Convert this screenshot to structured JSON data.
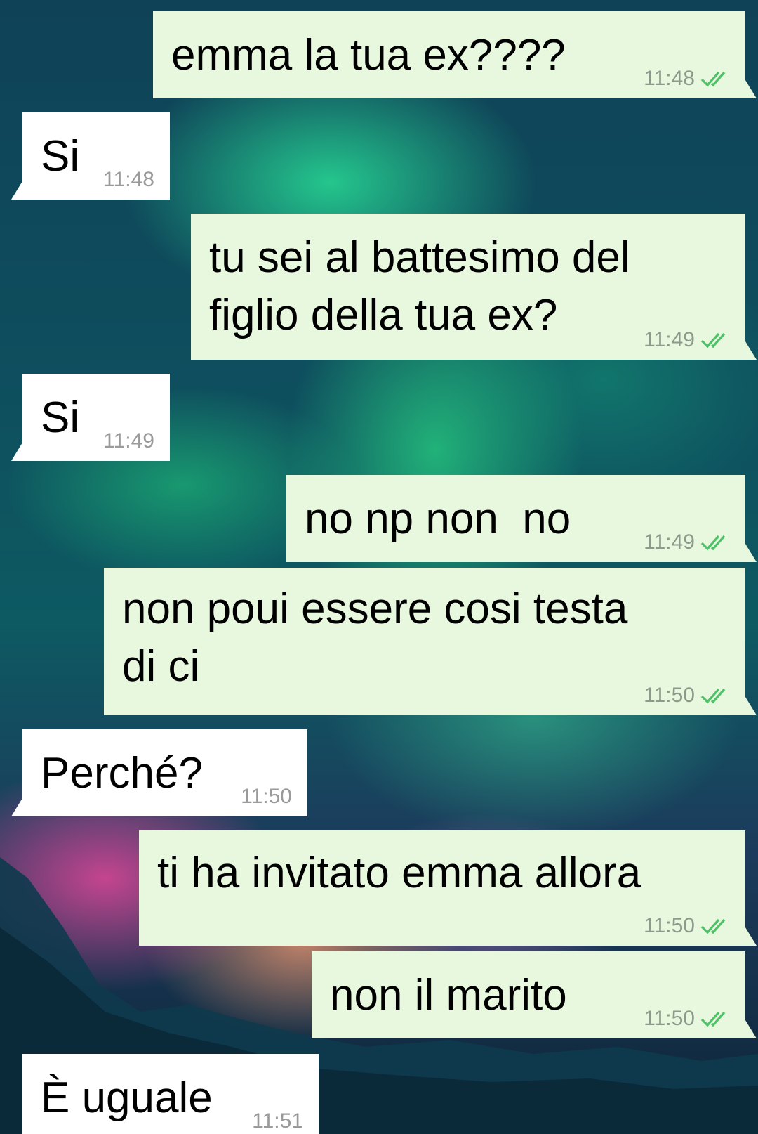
{
  "conversation": {
    "messages": [
      {
        "direction": "out",
        "lines": [
          "emma la tua ex????"
        ],
        "time": "11:48",
        "status": "read"
      },
      {
        "direction": "in",
        "lines": [
          "Si"
        ],
        "time": "11:48"
      },
      {
        "direction": "out",
        "lines": [
          "tu sei al battesimo del",
          "figlio della tua ex?"
        ],
        "time": "11:49",
        "status": "read"
      },
      {
        "direction": "in",
        "lines": [
          "Si"
        ],
        "time": "11:49"
      },
      {
        "direction": "out",
        "lines": [
          "no np non  no"
        ],
        "time": "11:49",
        "status": "read"
      },
      {
        "direction": "out",
        "lines": [
          "non poui essere cosi testa",
          "di ci"
        ],
        "time": "11:50",
        "status": "read"
      },
      {
        "direction": "in",
        "lines": [
          "Perché?"
        ],
        "time": "11:50"
      },
      {
        "direction": "out",
        "lines": [
          "ti ha invitato emma allora"
        ],
        "time": "11:50",
        "status": "read"
      },
      {
        "direction": "out",
        "lines": [
          "non il marito"
        ],
        "time": "11:50",
        "status": "read"
      },
      {
        "direction": "in",
        "lines": [
          "È uguale"
        ],
        "time": "11:51"
      }
    ]
  },
  "colors": {
    "outgoing_bubble": "#e7f8de",
    "incoming_bubble": "#ffffff",
    "read_ticks": "#4fc168",
    "timestamp": "#8c9a8c"
  },
  "icons": {
    "read_receipt": "double-check-icon"
  }
}
